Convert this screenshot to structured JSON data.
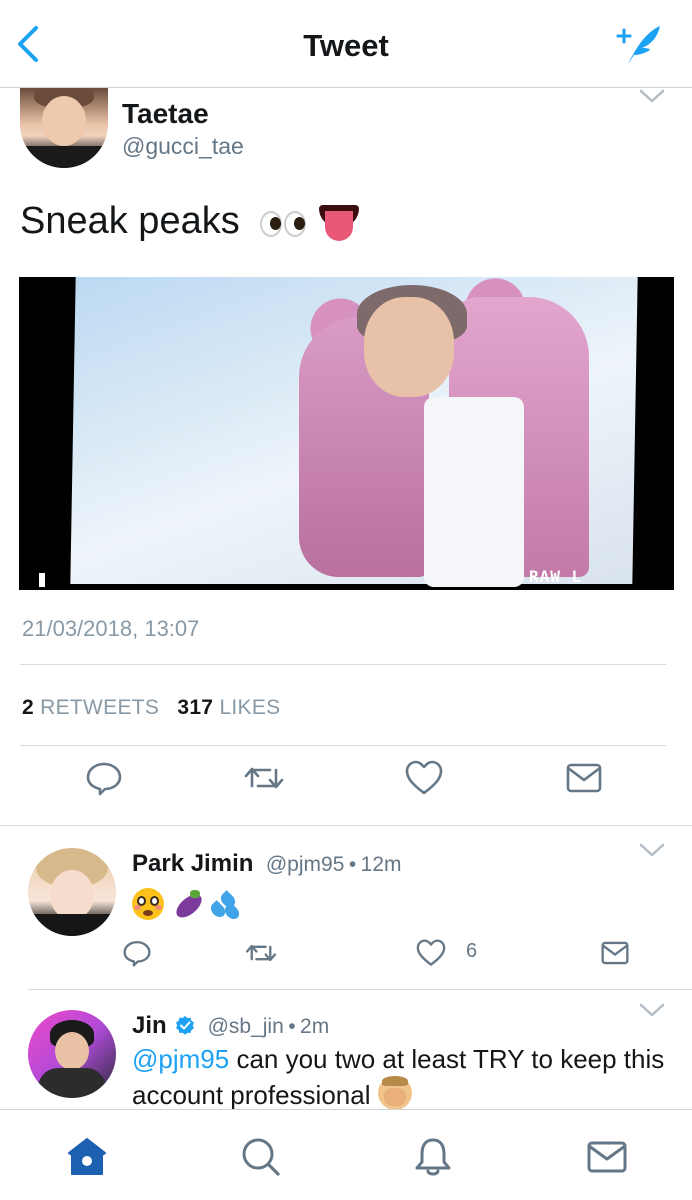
{
  "navbar": {
    "title": "Tweet",
    "back_icon": "chevron-left-icon",
    "compose_icon": "compose-tweet-icon",
    "accent_color": "#1da1f2"
  },
  "tweet": {
    "author_name": "Taetae",
    "author_handle": "@gucci_tae",
    "text": "Sneak peaks",
    "text_emojis": [
      "eyes-emoji",
      "tongue-emoji"
    ],
    "photo_overlay_text": "RAW L",
    "timestamp": "21/03/2018, 13:07",
    "retweet_count": "2",
    "retweets_label": "RETWEETS",
    "like_count": "317",
    "likes_label": "LIKES",
    "actions": [
      "reply-icon",
      "retweet-icon",
      "like-icon",
      "direct-message-icon"
    ]
  },
  "replies": [
    {
      "name": "Park Jimin",
      "handle": "@pjm95",
      "separator": "•",
      "time": "12m",
      "verified": false,
      "emojis": [
        "flushed-face-emoji",
        "eggplant-emoji",
        "sweat-droplets-emoji"
      ],
      "like_count": "6"
    },
    {
      "name": "Jin",
      "handle": "@sb_jin",
      "separator": "•",
      "time": "2m",
      "verified": true,
      "mention": "@pjm95",
      "text": "can you two at least TRY to keep this account professional",
      "trailing_emoji": "facepalm-emoji"
    }
  ],
  "tabbar": {
    "tabs": [
      "home-icon",
      "search-icon",
      "notifications-icon",
      "messages-icon"
    ],
    "active": "home-icon"
  }
}
